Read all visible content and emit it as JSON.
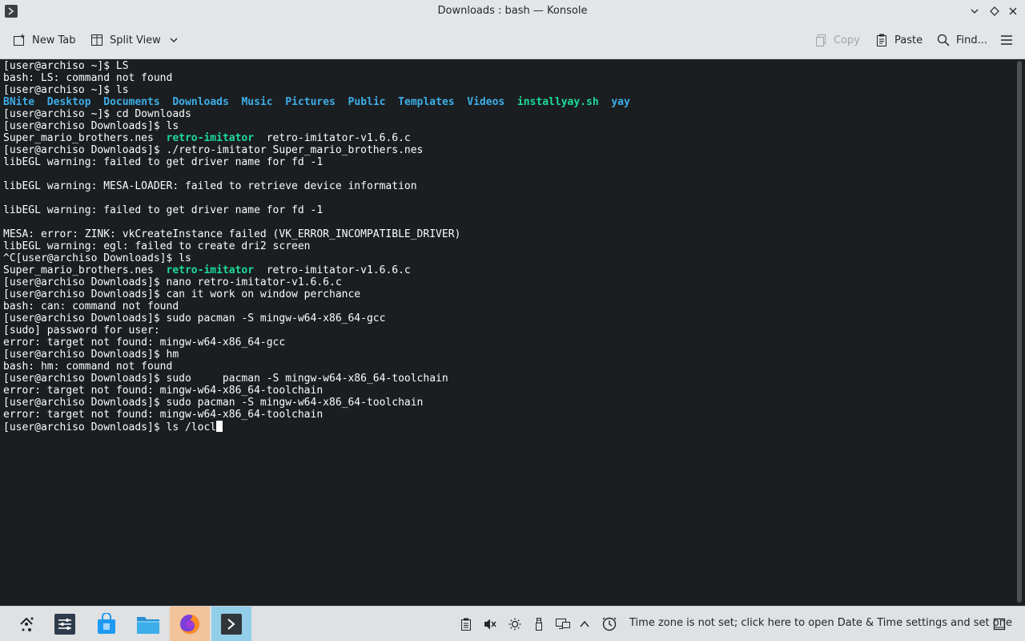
{
  "window": {
    "title": "Downloads : bash — Konsole"
  },
  "toolbar": {
    "new_tab": "New Tab",
    "split_view": "Split View",
    "copy": "Copy",
    "paste": "Paste",
    "find": "Find..."
  },
  "terminal": {
    "lines": [
      [
        {
          "t": "[user@archiso ~]$ LS",
          "c": ""
        }
      ],
      [
        {
          "t": "bash: LS: command not found",
          "c": ""
        }
      ],
      [
        {
          "t": "[user@archiso ~]$ ls",
          "c": ""
        }
      ],
      [
        {
          "t": "BNite",
          "c": "dir"
        },
        {
          "t": "  ",
          "c": ""
        },
        {
          "t": "Desktop",
          "c": "dir"
        },
        {
          "t": "  ",
          "c": ""
        },
        {
          "t": "Documents",
          "c": "dir"
        },
        {
          "t": "  ",
          "c": ""
        },
        {
          "t": "Downloads",
          "c": "dir"
        },
        {
          "t": "  ",
          "c": ""
        },
        {
          "t": "Music",
          "c": "dir"
        },
        {
          "t": "  ",
          "c": ""
        },
        {
          "t": "Pictures",
          "c": "dir"
        },
        {
          "t": "  ",
          "c": ""
        },
        {
          "t": "Public",
          "c": "dir"
        },
        {
          "t": "  ",
          "c": ""
        },
        {
          "t": "Templates",
          "c": "dir"
        },
        {
          "t": "  ",
          "c": ""
        },
        {
          "t": "Videos",
          "c": "dir"
        },
        {
          "t": "  ",
          "c": ""
        },
        {
          "t": "installyay.sh",
          "c": "exe"
        },
        {
          "t": "  ",
          "c": ""
        },
        {
          "t": "yay",
          "c": "dir"
        }
      ],
      [
        {
          "t": "[user@archiso ~]$ cd Downloads",
          "c": ""
        }
      ],
      [
        {
          "t": "[user@archiso Downloads]$ ls",
          "c": ""
        }
      ],
      [
        {
          "t": "Super_mario_brothers.nes  ",
          "c": ""
        },
        {
          "t": "retro-imitator",
          "c": "exe"
        },
        {
          "t": "  retro-imitator-v1.6.6.c",
          "c": ""
        }
      ],
      [
        {
          "t": "[user@archiso Downloads]$ ./retro-imitator Super_mario_brothers.nes",
          "c": ""
        }
      ],
      [
        {
          "t": "libEGL warning: failed to get driver name for fd -1",
          "c": ""
        }
      ],
      [
        {
          "t": "",
          "c": ""
        }
      ],
      [
        {
          "t": "libEGL warning: MESA-LOADER: failed to retrieve device information",
          "c": ""
        }
      ],
      [
        {
          "t": "",
          "c": ""
        }
      ],
      [
        {
          "t": "libEGL warning: failed to get driver name for fd -1",
          "c": ""
        }
      ],
      [
        {
          "t": "",
          "c": ""
        }
      ],
      [
        {
          "t": "MESA: error: ZINK: vkCreateInstance failed (VK_ERROR_INCOMPATIBLE_DRIVER)",
          "c": ""
        }
      ],
      [
        {
          "t": "libEGL warning: egl: failed to create dri2 screen",
          "c": ""
        }
      ],
      [
        {
          "t": "^C[user@archiso Downloads]$ ls",
          "c": ""
        }
      ],
      [
        {
          "t": "Super_mario_brothers.nes  ",
          "c": ""
        },
        {
          "t": "retro-imitator",
          "c": "exe"
        },
        {
          "t": "  retro-imitator-v1.6.6.c",
          "c": ""
        }
      ],
      [
        {
          "t": "[user@archiso Downloads]$ nano retro-imitator-v1.6.6.c",
          "c": ""
        }
      ],
      [
        {
          "t": "[user@archiso Downloads]$ can it work on window perchance",
          "c": ""
        }
      ],
      [
        {
          "t": "bash: can: command not found",
          "c": ""
        }
      ],
      [
        {
          "t": "[user@archiso Downloads]$ sudo pacman -S mingw-w64-x86_64-gcc",
          "c": ""
        }
      ],
      [
        {
          "t": "[sudo] password for user:",
          "c": ""
        }
      ],
      [
        {
          "t": "error: target not found: mingw-w64-x86_64-gcc",
          "c": ""
        }
      ],
      [
        {
          "t": "[user@archiso Downloads]$ hm",
          "c": ""
        }
      ],
      [
        {
          "t": "bash: hm: command not found",
          "c": ""
        }
      ],
      [
        {
          "t": "[user@archiso Downloads]$ sudo     pacman -S mingw-w64-x86_64-toolchain",
          "c": ""
        }
      ],
      [
        {
          "t": "error: target not found: mingw-w64-x86_64-toolchain",
          "c": ""
        }
      ],
      [
        {
          "t": "[user@archiso Downloads]$ sudo pacman -S mingw-w64-x86_64-toolchain",
          "c": ""
        }
      ],
      [
        {
          "t": "error: target not found: mingw-w64-x86_64-toolchain",
          "c": ""
        }
      ],
      [
        {
          "t": "[user@archiso Downloads]$ ls /locl",
          "c": ""
        }
      ]
    ]
  },
  "taskbar": {
    "apps": [
      {
        "icon": "app-launcher-icon",
        "state": "none"
      },
      {
        "icon": "system-settings-icon",
        "state": "none"
      },
      {
        "icon": "discover-store-icon",
        "state": "none"
      },
      {
        "icon": "file-manager-icon",
        "state": "none"
      },
      {
        "icon": "firefox-icon",
        "state": "open"
      },
      {
        "icon": "konsole-icon",
        "state": "active"
      }
    ],
    "tray": {
      "clock_message": "Time zone is not set; click here to open Date & Time settings and set one"
    }
  },
  "colors": {
    "terminal_bg": "#1b1e20",
    "directory": "#3daee9",
    "executable": "#1cdc9a",
    "text": "#fcfcfc"
  }
}
